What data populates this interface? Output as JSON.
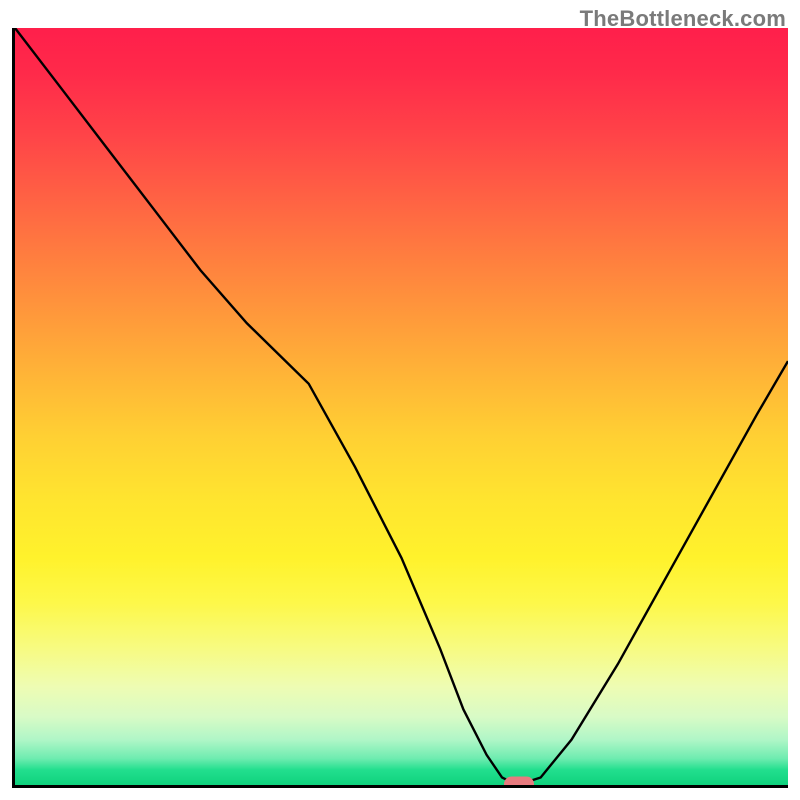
{
  "watermark": {
    "text": "TheBottleneck.com"
  },
  "chart_data": {
    "type": "line",
    "title": "",
    "xlabel": "",
    "ylabel": "",
    "xlim": [
      0,
      100
    ],
    "ylim": [
      0,
      100
    ],
    "grid": false,
    "legend": false,
    "background": {
      "type": "vertical-gradient",
      "top_color": "#ff1f4b",
      "bottom_color": "#0fd27d",
      "meaning": "red = high bottleneck, green = low bottleneck"
    },
    "series": [
      {
        "name": "bottleneck-curve",
        "color": "#000000",
        "x": [
          0,
          6,
          12,
          18,
          24,
          30,
          34,
          38,
          44,
          50,
          55,
          58,
          61,
          63,
          65,
          68,
          72,
          78,
          84,
          90,
          96,
          100
        ],
        "y": [
          100,
          92,
          84,
          76,
          68,
          61,
          57,
          53,
          42,
          30,
          18,
          10,
          4,
          1,
          0,
          1,
          6,
          16,
          27,
          38,
          49,
          56
        ]
      }
    ],
    "marker": {
      "name": "optimal-point",
      "x": 65,
      "y": 0,
      "color": "#e87b7f"
    }
  }
}
